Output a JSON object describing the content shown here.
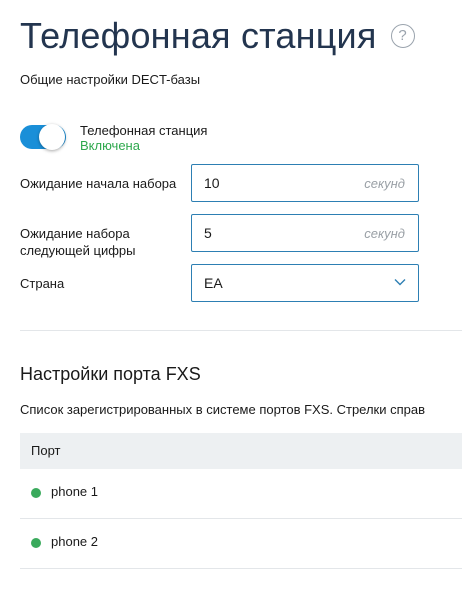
{
  "page": {
    "title": "Телефонная станция",
    "help_icon": "?",
    "subtitle": "Общие настройки DECT-базы"
  },
  "station_toggle": {
    "label": "Телефонная станция",
    "status": "Включена",
    "enabled": true,
    "accent": "#1a8fd8",
    "status_color": "#2ea84d"
  },
  "fields": {
    "dial_start": {
      "label": "Ожидание начала набора",
      "value": "10",
      "unit": "секунд"
    },
    "next_digit": {
      "label": "Ожидание набора следующей цифры",
      "value": "5",
      "unit": "секунд"
    },
    "country": {
      "label": "Страна",
      "value": "EA",
      "icon": "chevron-down-icon"
    }
  },
  "fxs": {
    "title": "Настройки порта FXS",
    "description": "Список зарегистрированных в системе портов FXS. Стрелки справ",
    "table": {
      "columns": [
        "Порт"
      ],
      "rows": [
        {
          "name": "phone 1",
          "status": "online",
          "status_color": "#3aaa5c"
        },
        {
          "name": "phone 2",
          "status": "online",
          "status_color": "#3aaa5c"
        }
      ]
    }
  }
}
